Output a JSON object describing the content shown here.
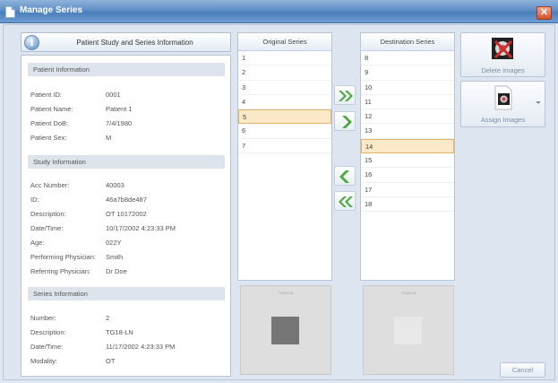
{
  "window": {
    "title": "Manage Series",
    "close_glyph": "✕"
  },
  "info_header": {
    "label": "Patient Study and Series Information",
    "icon": "info-icon",
    "icon_glyph": "i"
  },
  "patient": {
    "heading": "Patient Information",
    "fields": [
      {
        "label": "Patient ID:",
        "value": "0001"
      },
      {
        "label": "Patient Name:",
        "value": "Patient 1"
      },
      {
        "label": "Patient DoB:",
        "value": "7/4/1980"
      },
      {
        "label": "Patient Sex:",
        "value": "M"
      }
    ]
  },
  "study": {
    "heading": "Study Information",
    "fields": [
      {
        "label": "Acc Number:",
        "value": "40003"
      },
      {
        "label": "ID:",
        "value": "46a7b8de487"
      },
      {
        "label": "Description:",
        "value": "OT 10172002"
      },
      {
        "label": "Date/Time:",
        "value": "10/17/2002 4:23:33 PM"
      },
      {
        "label": "Age:",
        "value": "022Y"
      },
      {
        "label": "Performing Physician:",
        "value": "Smith"
      },
      {
        "label": "Referring Physician:",
        "value": "Dr Doe"
      }
    ]
  },
  "series": {
    "heading": "Series Information",
    "fields": [
      {
        "label": "Number:",
        "value": "2"
      },
      {
        "label": "Description:",
        "value": "TG18-LN"
      },
      {
        "label": "Date/Time:",
        "value": "11/17/2002 4:23:33 PM"
      },
      {
        "label": "Modality:",
        "value": "OT"
      }
    ]
  },
  "original_series": {
    "header": "Original Series",
    "items": [
      "1",
      "2",
      "3",
      "4",
      "5",
      "6",
      "7"
    ],
    "selected": "5"
  },
  "destination_series": {
    "header": "Destination Series",
    "items": [
      "8",
      "9",
      "10",
      "11",
      "12",
      "13",
      "14",
      "15",
      "16",
      "17",
      "18"
    ],
    "selected": "14"
  },
  "arrows": {
    "move_all_right": "double-chevron-right-icon",
    "move_right": "chevron-right-icon",
    "move_left": "chevron-left-icon",
    "move_all_left": "double-chevron-left-icon"
  },
  "actions": {
    "delete_label": "Delete Images",
    "assign_label": "Assign Images",
    "cancel_label": "Cancel"
  },
  "colors": {
    "title_bar": "#5f8fc6",
    "selection": "#fde9c7",
    "arrow_green": "#4caa3a",
    "close_red": "#d2512c"
  }
}
